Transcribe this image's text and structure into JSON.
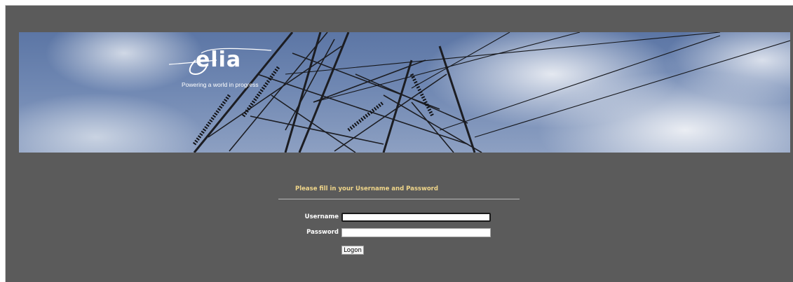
{
  "banner": {
    "logo_text": "elia",
    "tagline": "Powering a world in progress"
  },
  "login": {
    "prompt": "Please fill in your Username and Password",
    "username_label": "Username",
    "username_value": "",
    "password_label": "Password",
    "password_value": "",
    "submit_label": "Logon"
  },
  "colors": {
    "background": "#5b5b5b",
    "prompt_text": "#f0d68a",
    "sky": "#6f87b2"
  }
}
